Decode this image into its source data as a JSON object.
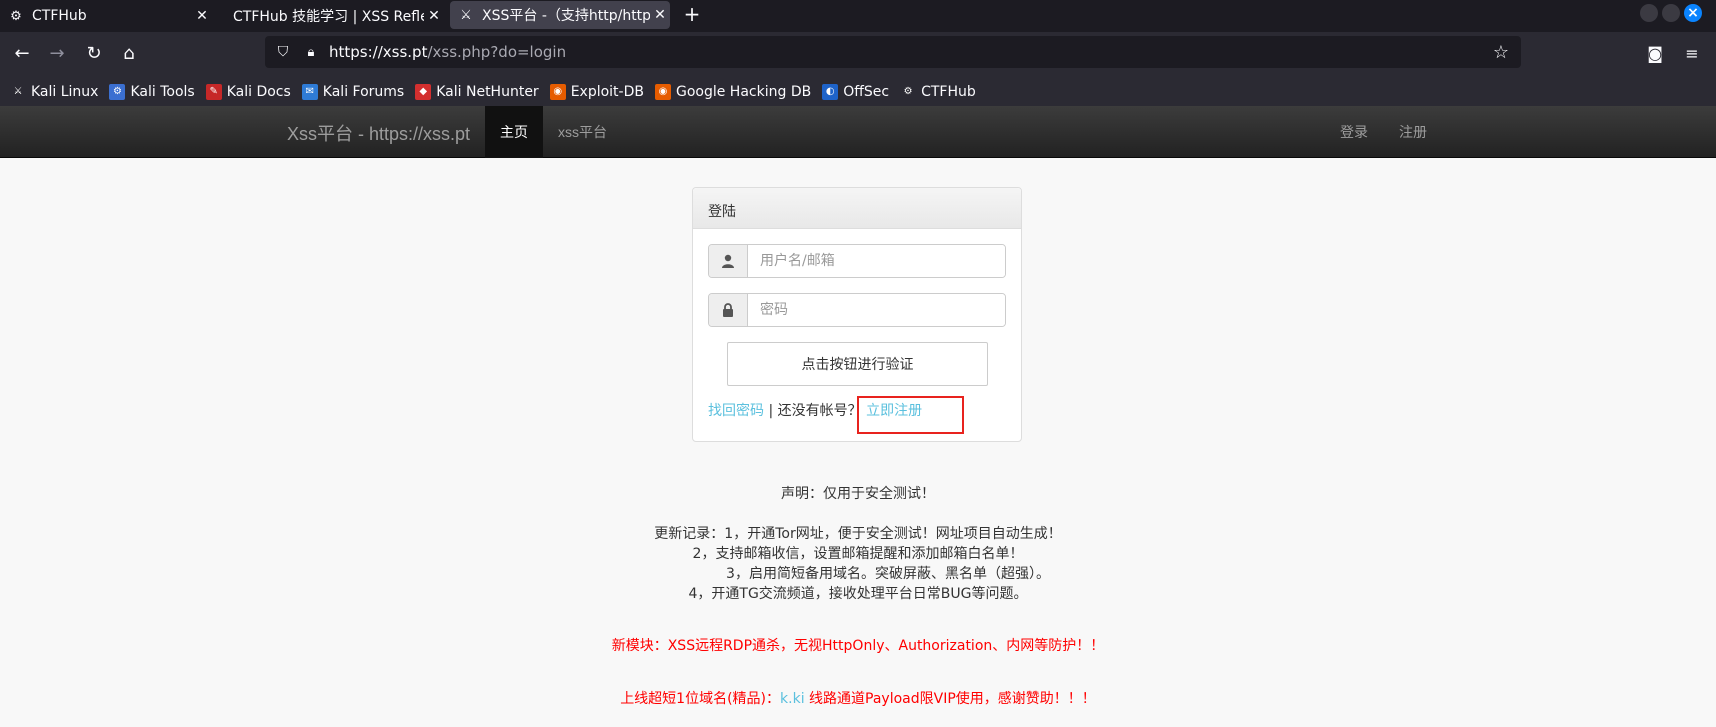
{
  "browser": {
    "tabs": [
      {
        "title": "CTFHub",
        "icon": "ctfhub-icon"
      },
      {
        "title": "CTFHub 技能学习 | XSS Reflec",
        "icon": ""
      },
      {
        "title": "XSS平台 -（支持http/http",
        "icon": "kali-icon"
      }
    ],
    "new_tab": "+",
    "url_host": "https://xss.pt",
    "url_path": "/xss.php?do=login",
    "bookmarks": [
      {
        "label": "Kali Linux",
        "color": "#2b2a33"
      },
      {
        "label": "Kali Tools",
        "color": "#3b6fd1"
      },
      {
        "label": "Kali Docs",
        "color": "#c62828"
      },
      {
        "label": "Kali Forums",
        "color": "#2e7bd6"
      },
      {
        "label": "Kali NetHunter",
        "color": "#d32f2f"
      },
      {
        "label": "Exploit-DB",
        "color": "#e65c00"
      },
      {
        "label": "Google Hacking DB",
        "color": "#e65c00"
      },
      {
        "label": "OffSec",
        "color": "#1e63c9"
      },
      {
        "label": "CTFHub",
        "color": "#2b2a33"
      }
    ]
  },
  "site": {
    "brand": "Xss平台 - https://xss.pt",
    "nav": {
      "home": "主页",
      "platform": "xss平台",
      "login": "登录",
      "register": "注册"
    }
  },
  "login": {
    "heading": "登陆",
    "username_placeholder": "用户名/邮箱",
    "password_placeholder": "密码",
    "verify_button": "点击按钮进行验证",
    "forgot": "找回密码",
    "separator": " | 还没有帐号？",
    "register_now": "立即注册"
  },
  "notices": {
    "declaration": "声明：仅用于安全测试！",
    "update1": "更新记录：1，开通Tor网址，便于安全测试！网址项目自动生成！",
    "update2": "2，支持邮箱收信，设置邮箱提醒和添加邮箱白名单！",
    "update3": "3，启用简短备用域名。突破屏蔽、黑名单（超强）。",
    "update4": "4，开通TG交流频道，接收处理平台日常BUG等问题。",
    "new_module": "新模块：XSS远程RDP通杀，无视HttpOnly、Authorization、内网等防护！！",
    "domain_prefix": "上线超短1位域名(精品)：",
    "domain_link": "k.ki",
    "domain_suffix": " 线路通道Payload限VIP使用，感谢赞助！！！"
  },
  "colors": {
    "accent": "#5bc0de",
    "alert": "#ff0000",
    "highlight_box": "#e8231e"
  }
}
